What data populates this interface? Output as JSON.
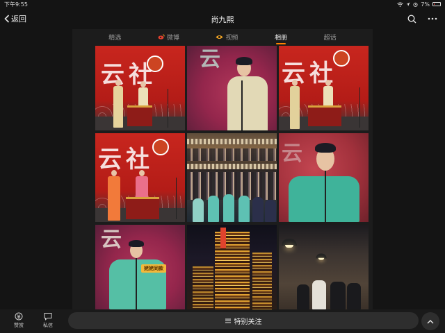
{
  "status": {
    "time": "下午9:55",
    "battery": "7%"
  },
  "nav": {
    "back_label": "返回",
    "title": "尚九熙"
  },
  "tabs": [
    {
      "label": "精选",
      "icon": "none",
      "active": false
    },
    {
      "label": "微博",
      "icon": "weibo-icon",
      "active": false
    },
    {
      "label": "视频",
      "icon": "video-eye-icon",
      "active": false
    },
    {
      "label": "相册",
      "icon": "none",
      "active": true
    },
    {
      "label": "超话",
      "icon": "none",
      "active": false
    }
  ],
  "photos": {
    "stage_calligraphy": "云社",
    "sticker_text": "姥姥同款"
  },
  "bottom": {
    "reward_label": "赞赏",
    "message_label": "私信",
    "follow_label": "特别关注"
  },
  "colors": {
    "accent": "#ff8200",
    "background": "#141414",
    "panel": "#1c1c1c",
    "pill": "#2e2e2e"
  }
}
